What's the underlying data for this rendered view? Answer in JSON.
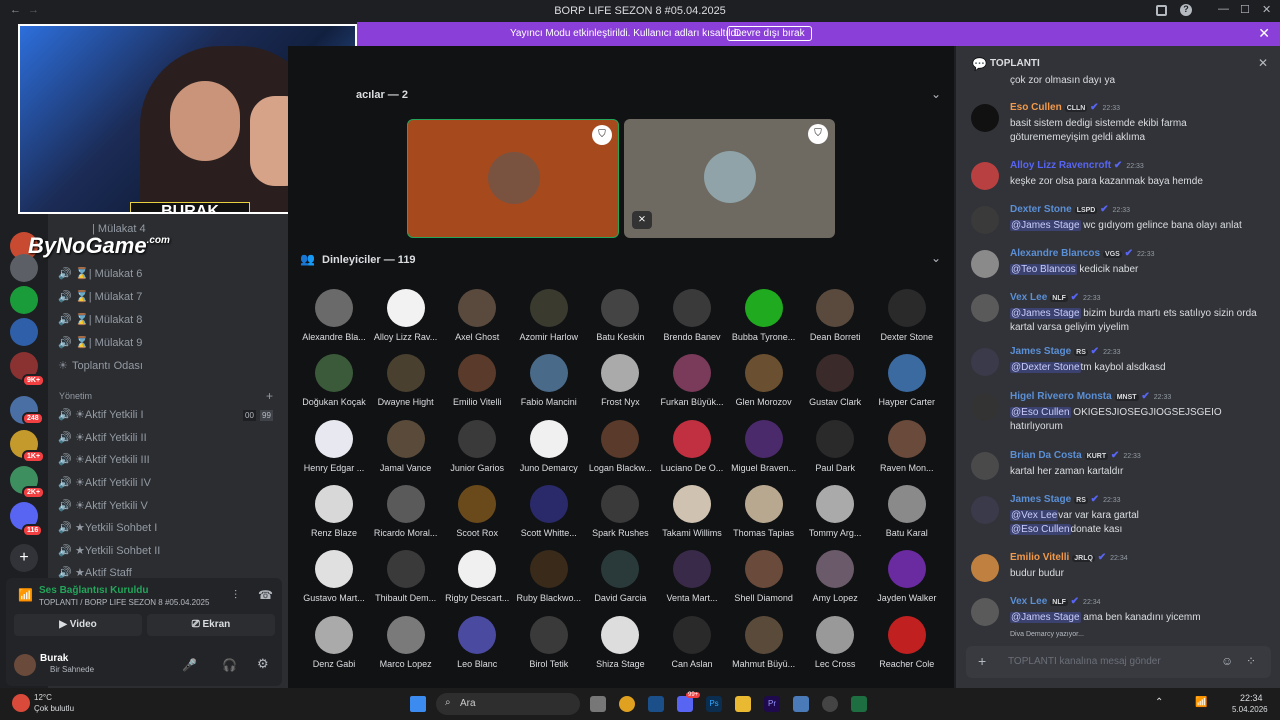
{
  "titlebar": {
    "title": "BORP LIFE SEZON 8 #05.04.2025"
  },
  "banner": {
    "text": "Yayıncı Modu etkinleştirildi. Kullanıcı adları kısaltıldı.",
    "button": "Devre dışı bırak"
  },
  "servers": {
    "badges": [
      "9K+",
      "248",
      "1K+",
      "2K+",
      "116"
    ]
  },
  "channels": {
    "items": [
      {
        "label": "| Mülakat 6"
      },
      {
        "label": "| Mülakat 7"
      },
      {
        "label": "| Mülakat 8"
      },
      {
        "label": "| Mülakat 9"
      },
      {
        "label": "Toplantı Odası"
      }
    ],
    "category": "Yönetim",
    "admin_items": [
      {
        "label": "Aktif Yetkili I"
      },
      {
        "label": "Aktif Yetkili II"
      },
      {
        "label": "Aktif Yetkili III"
      },
      {
        "label": "Aktif Yetkili IV"
      },
      {
        "label": "Aktif Yetkili V"
      },
      {
        "label": "Yetkili Sohbet I"
      },
      {
        "label": "Yetkili Sohbet II"
      },
      {
        "label": "Aktif Staff"
      }
    ],
    "counts": [
      "00",
      "99"
    ]
  },
  "voice": {
    "status": "Ses Bağlantısı Kuruldu",
    "channel": "TOPLANTI / BORP LIFE SEZON 8 #05.04.2025",
    "video": "Video",
    "screen": "Ekran",
    "user": "Burak",
    "user_status": "Bir Sahnede"
  },
  "webcam": {
    "name": "BURAK",
    "watermark": "ByNoGame",
    "watermark_suffix": ".com",
    "partial_label": "| Mülakat 4"
  },
  "stage": {
    "speakers_header": "acılar — 2",
    "listeners_header": "Dinleyiciler — 119"
  },
  "listeners": [
    "Alexandre Bla...",
    "Alloy Lizz Rav...",
    "Axel Ghost",
    "Azomir Harlow",
    "Batu Keskin",
    "Brendo Banev",
    "Bubba Tyrone...",
    "Dean Borreti",
    "Dexter Stone",
    "Doğukan Koçak",
    "Dwayne Hight",
    "Emilio Vitelli",
    "Fabio Mancini",
    "Frost Nyx",
    "Furkan Büyük...",
    "Glen Morozov",
    "Gustav Clark",
    "Hayper Carter",
    "Henry Edgar ...",
    "Jamal Vance",
    "Junior Garios",
    "Juno Demarcy",
    "Logan Blackw...",
    "Luciano De O...",
    "Miguel Braven...",
    "Paul Dark",
    "Raven Mon...",
    "Renz Blaze",
    "Ricardo Moral...",
    "Scoot Rox",
    "Scott Whitte...",
    "Spark Rushes",
    "Takami Willims",
    "Thomas Tapias",
    "Tommy Arg...",
    "Batu Karal",
    "Gustavo Mart...",
    "Thibault Dem...",
    "Rigby Descart...",
    "Ruby Blackwo...",
    "David Garcia",
    "Venta Mart...",
    "Shell Diamond",
    "Amy Lopez",
    "Jayden Walker",
    "Denz Gabi",
    "Marco Lopez",
    "Leo Blanc",
    "Birol Tetik",
    "Shiza Stage",
    "Can Aslan",
    "Mahmut Büyü...",
    "Lec Cross",
    "Reacher Cole"
  ],
  "chat": {
    "title": "TOPLANTI",
    "first_line": "çok zor olmasın dayı ya",
    "messages": [
      {
        "name": "Eso Cullen",
        "tag": "CLLN",
        "time": "22:33",
        "color": "#f2994a",
        "lines": [
          "basit sistem dedigi sistemde ekibi farma",
          "göturememeyişim geldi aklıma"
        ]
      },
      {
        "name": "Alloy Lizz Ravencroft",
        "tag": "",
        "time": "22:33",
        "color": "#5865f2",
        "lines": [
          "keşke zor olsa para kazanmak baya hemde"
        ]
      },
      {
        "name": "Dexter Stone",
        "tag": "LSPD",
        "time": "22:33",
        "color": "#5b8fd6",
        "mention": "@James Stage",
        "text": " wc gıdıyom gelince bana olayı anlat"
      },
      {
        "name": "Alexandre Blancos",
        "tag": "VGS",
        "time": "22:33",
        "color": "#5b8fd6",
        "mention": "@Teo Blancos",
        "text": " kedicik naber"
      },
      {
        "name": "Vex Lee",
        "tag": "NLF",
        "time": "22:33",
        "color": "#5b8fd6",
        "mention": "@James Stage",
        "text": "  bizim burda martı ets satılıyo sizin orda kartal varsa geliyim yiyelim"
      },
      {
        "name": "James Stage",
        "tag": "RS",
        "time": "22:33",
        "color": "#5b8fd6",
        "mention": "@Dexter Stone",
        "text": "tm kaybol alsdkasd"
      },
      {
        "name": "Higel Riveero Monsta",
        "tag": "MNST",
        "time": "22:33",
        "color": "#5b8fd6",
        "mention": "@Eso Cullen",
        "text": " OKIGESJIOSEGJIOGSEJSGEIO hatırlıyorum"
      },
      {
        "name": "Brian Da Costa",
        "tag": "KURT",
        "time": "22:33",
        "color": "#5b8fd6",
        "lines": [
          "kartal her zaman kartaldır"
        ]
      },
      {
        "name": "James Stage",
        "tag": "RS",
        "time": "22:33",
        "color": "#5b8fd6",
        "mention": "@Vex Lee",
        "text": "var var kara gartal",
        "mention2": "@Eso Cullen",
        "text2": "donate kası"
      },
      {
        "name": "Emilio Vitelli",
        "tag": "JRLQ",
        "time": "22:34",
        "color": "#f2994a",
        "lines": [
          "budur budur"
        ]
      },
      {
        "name": "Vex Lee",
        "tag": "NLF",
        "time": "22:34",
        "color": "#5b8fd6",
        "mention": "@James Stage",
        "text": " ama ben kanadını yicemm"
      }
    ],
    "typing": "Diva Demarcy yazıyor...",
    "placeholder": "TOPLANTI kanalına mesaj gönder"
  },
  "taskbar": {
    "weather": "12°C",
    "weather_desc": "Çok bulutlu",
    "search": "Ara",
    "time": "22:34",
    "date": "5.04.2026",
    "notif": "99+"
  }
}
